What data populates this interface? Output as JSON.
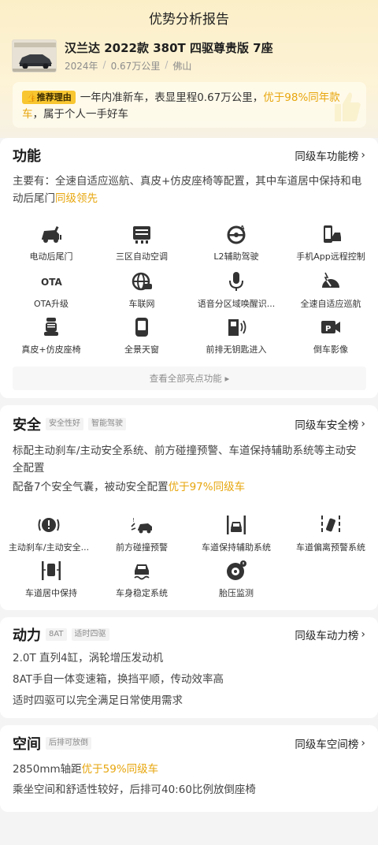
{
  "page_title": "优势分析报告",
  "car": {
    "name": "汉兰达 2022款 380T 四驱尊贵版 7座",
    "year": "2024年",
    "mileage": "0.67万公里",
    "city": "佛山",
    "separator": "/"
  },
  "reason": {
    "tag": "推荐理由",
    "text_a": "一年内准新车，表显里程0.67万公里，",
    "text_highlight": "优于98%同年款车",
    "text_b": "，属于个人一手好车"
  },
  "function": {
    "title": "功能",
    "link": "同级车功能榜",
    "desc_a": "主要有：全速自适应巡航、真皮+仿皮座椅等配置，其中车道居中保持和电动后尾门",
    "desc_highlight": "同级领先",
    "features": [
      {
        "label": "电动后尾门",
        "icon": "tailgate-icon"
      },
      {
        "label": "三区自动空调",
        "icon": "climate-icon"
      },
      {
        "label": "L2辅助驾驶",
        "icon": "steering-assist-icon"
      },
      {
        "label": "手机App远程控制",
        "icon": "phone-remote-icon"
      },
      {
        "label": "OTA升级",
        "icon": "ota-icon"
      },
      {
        "label": "车联网",
        "icon": "globe-car-icon"
      },
      {
        "label": "语音分区域唤醒识...",
        "icon": "microphone-icon"
      },
      {
        "label": "全速自适应巡航",
        "icon": "speedometer-icon"
      },
      {
        "label": "真皮+仿皮座椅",
        "icon": "seat-icon"
      },
      {
        "label": "全景天窗",
        "icon": "sunroof-icon"
      },
      {
        "label": "前排无钥匙进入",
        "icon": "keyless-door-icon"
      },
      {
        "label": "倒车影像",
        "icon": "reverse-camera-icon"
      }
    ],
    "view_all": "查看全部亮点功能"
  },
  "safety": {
    "title": "安全",
    "tags": [
      "安全性好",
      "智能驾驶"
    ],
    "link": "同级车安全榜",
    "desc1": "标配主动刹车/主动安全系统、前方碰撞预警、车道保持辅助系统等主动安全配置",
    "desc2_a": "配备7个安全气囊，被动安全配置",
    "desc2_highlight": "优于97%同级车",
    "features": [
      {
        "label": "主动刹车/主动安全...",
        "icon": "brake-warning-icon"
      },
      {
        "label": "前方碰撞预警",
        "icon": "collision-warning-icon"
      },
      {
        "label": "车道保持辅助系统",
        "icon": "lane-keep-icon"
      },
      {
        "label": "车道偏离预警系统",
        "icon": "lane-departure-icon"
      },
      {
        "label": "车道居中保持",
        "icon": "lane-center-icon"
      },
      {
        "label": "车身稳定系统",
        "icon": "stability-icon"
      },
      {
        "label": "胎压监测",
        "icon": "tire-pressure-icon"
      }
    ]
  },
  "power": {
    "title": "动力",
    "tags": [
      "8AT",
      "适时四驱"
    ],
    "link": "同级车动力榜",
    "lines": [
      "2.0T 直列4缸，涡轮增压发动机",
      "8AT手自一体变速箱，换挡平顺，传动效率高",
      "适时四驱可以完全满足日常使用需求"
    ]
  },
  "space": {
    "title": "空间",
    "tags": [
      "后排可放倒"
    ],
    "link": "同级车空间榜",
    "line1_a": "2850mm轴距",
    "line1_highlight": "优于59%同级车",
    "line2": "乘坐空间和舒适性较好，后排可40:60比例放倒座椅"
  },
  "colors": {
    "accent": "#e7a60e",
    "tag_yellow": "#f8c630",
    "hero_bg": "#fbefc8"
  }
}
